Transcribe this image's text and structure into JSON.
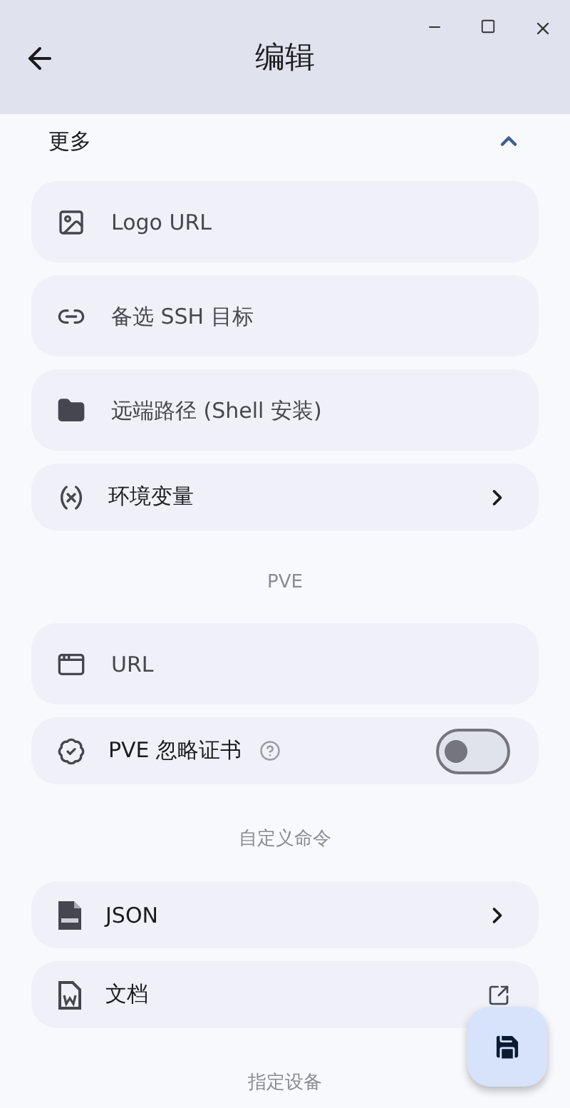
{
  "window": {
    "title": "编辑"
  },
  "section": {
    "title": "更多",
    "expanded": true
  },
  "items": [
    {
      "kind": "field",
      "placeholder": "Logo URL"
    },
    {
      "kind": "field",
      "placeholder": "备选 SSH 目标"
    },
    {
      "kind": "field",
      "placeholder": "远端路径 (Shell 安装)"
    },
    {
      "kind": "nav",
      "label": "环境变量"
    },
    {
      "kind": "heading",
      "label": "PVE"
    },
    {
      "kind": "field",
      "placeholder": "URL"
    },
    {
      "kind": "toggle",
      "label": "PVE 忽略证书",
      "on": false
    },
    {
      "kind": "heading",
      "label": "自定义命令"
    },
    {
      "kind": "nav",
      "label": "JSON"
    },
    {
      "kind": "link",
      "label": "文档"
    },
    {
      "kind": "heading",
      "label": "指定设备"
    }
  ]
}
